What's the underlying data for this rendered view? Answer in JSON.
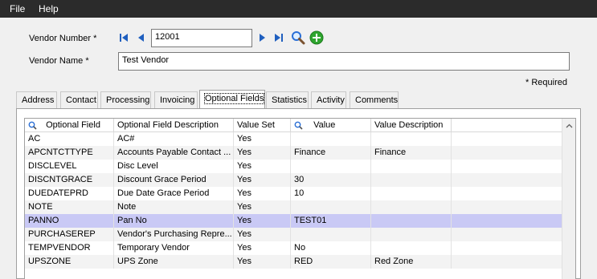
{
  "menu": {
    "file": "File",
    "help": "Help"
  },
  "vendor": {
    "number_label": "Vendor Number *",
    "number_value": "12001",
    "name_label": "Vendor Name *",
    "name_value": "Test Vendor"
  },
  "required_note": "* Required",
  "tabs": [
    "Address",
    "Contact",
    "Processing",
    "Invoicing",
    "Optional Fields",
    "Statistics",
    "Activity",
    "Comments"
  ],
  "active_tab": "Optional Fields",
  "grid": {
    "columns": [
      "Optional Field",
      "Optional Field Description",
      "Value Set",
      "Value",
      "Value Description"
    ],
    "rows": [
      [
        "AC",
        "AC#",
        "Yes",
        "",
        ""
      ],
      [
        "APCNTCTTYPE",
        "Accounts Payable Contact ...",
        "Yes",
        "Finance",
        "Finance"
      ],
      [
        "DISCLEVEL",
        "Disc Level",
        "Yes",
        "",
        ""
      ],
      [
        "DISCNTGRACE",
        "Discount Grace Period",
        "Yes",
        "30",
        ""
      ],
      [
        "DUEDATEPRD",
        "Due Date Grace Period",
        "Yes",
        "10",
        ""
      ],
      [
        "NOTE",
        "Note",
        "Yes",
        "",
        ""
      ],
      [
        "PANNO",
        "Pan No",
        "Yes",
        "TEST01",
        ""
      ],
      [
        "PURCHASEREP",
        "Vendor's Purchasing Repre...",
        "Yes",
        "",
        ""
      ],
      [
        "TEMPVENDOR",
        "Temporary Vendor",
        "Yes",
        "No",
        ""
      ],
      [
        "UPSZONE",
        "UPS Zone",
        "Yes",
        "RED",
        "Red Zone"
      ]
    ],
    "selected_row": 6
  },
  "colors": {
    "menubar": "#2b2b2b",
    "selected_row": "#c9c9f5",
    "nav_blue": "#1f5fbf",
    "add_green": "#2ea52e"
  }
}
